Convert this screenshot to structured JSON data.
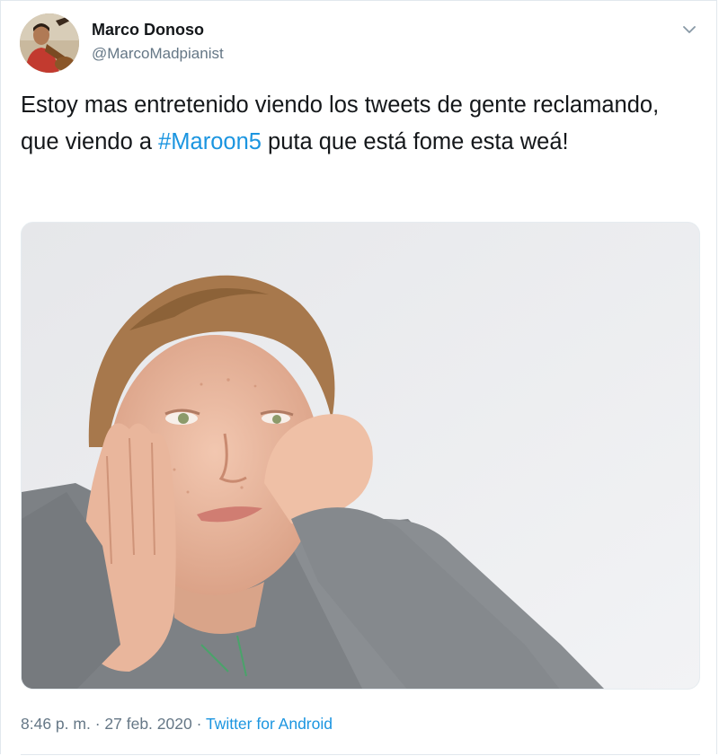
{
  "tweet": {
    "author_name": "Marco Donoso",
    "author_handle": "@MarcoMadpianist",
    "text_before": "Estoy mas entretenido viendo los tweets de gente reclamando, que viendo a ",
    "hashtag": "#Maroon5",
    "text_after": " puta que está fome esta weá!",
    "time": "8:46 p. m.",
    "separator": " · ",
    "date": "27 feb. 2020",
    "source": "Twitter for Android"
  },
  "icons": {
    "menu": "chevron-down-icon"
  },
  "colors": {
    "link": "#1b95e0",
    "secondary_text": "#657786",
    "primary_text": "#14171a",
    "border": "#e1e8ed"
  }
}
